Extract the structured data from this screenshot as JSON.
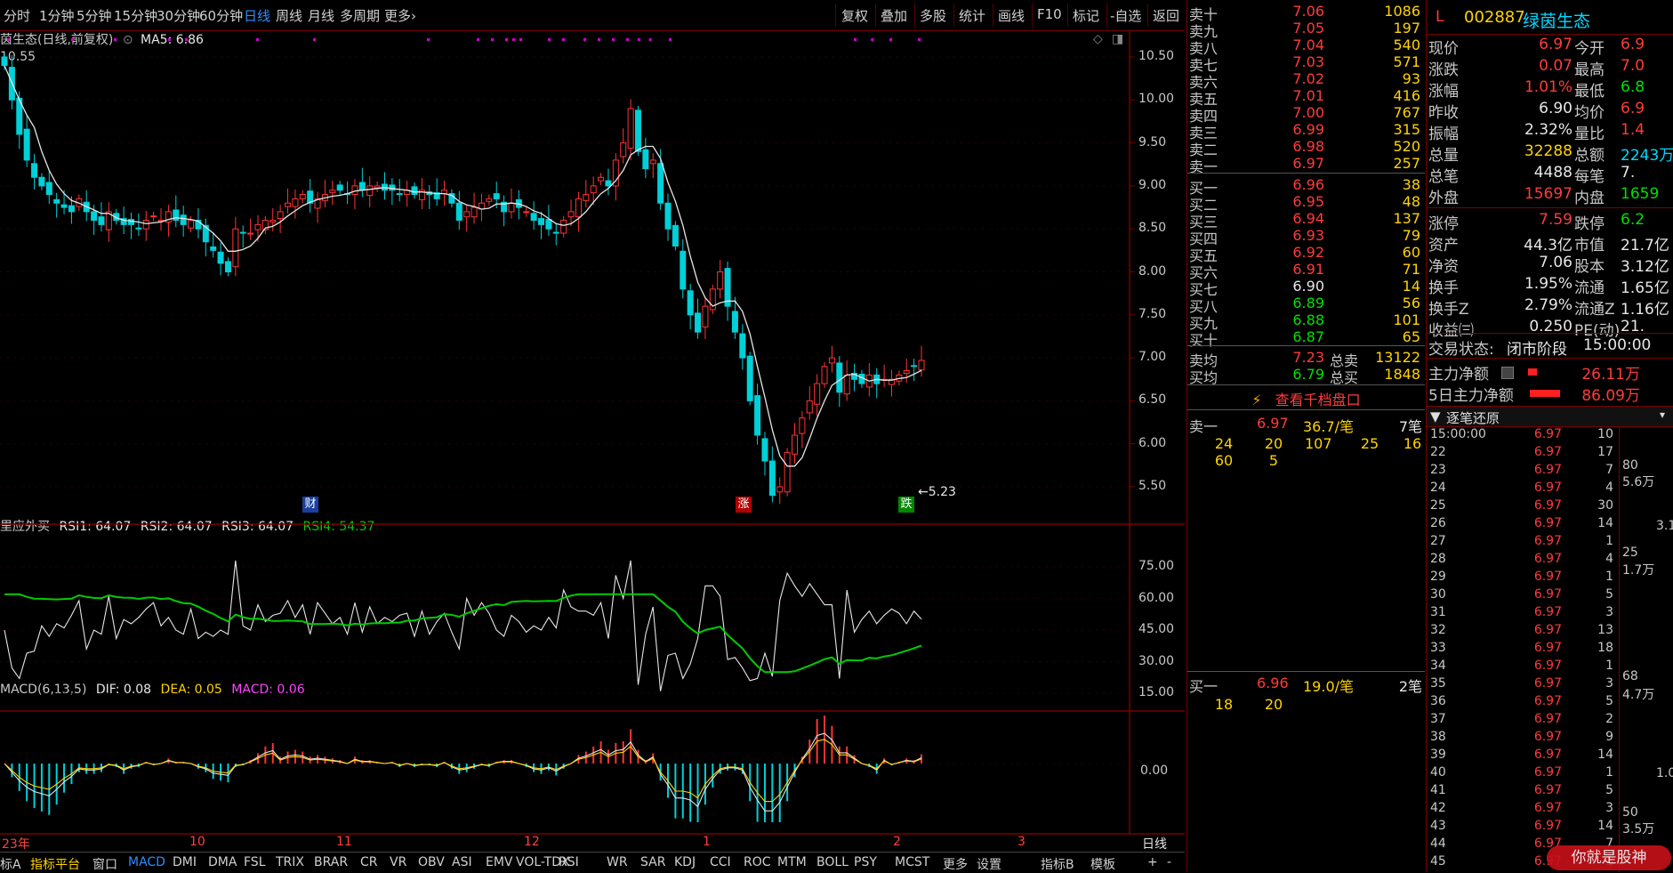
{
  "toolbar": {
    "periods": [
      "分时",
      "1分钟",
      "5分钟",
      "15分钟",
      "30分钟",
      "60分钟",
      "日线",
      "周线",
      "月线",
      "多周期",
      "更多"
    ],
    "active_period": "日线",
    "right_buttons": [
      "复权",
      "叠加",
      "多股",
      "统计",
      "画线",
      "F10",
      "标记",
      "-自选",
      "返回"
    ]
  },
  "main_chart": {
    "title": "茵生态(日线,前复权)",
    "ma_label": "MA5: 6.86",
    "top_price": "10.55",
    "y_ticks": [
      "10.50",
      "10.00",
      "9.50",
      "9.00",
      "8.50",
      "8.00",
      "7.50",
      "7.00",
      "6.50",
      "6.00",
      "5.50"
    ],
    "low_marker": "5.23",
    "event_markers": [
      "财",
      "涨",
      "跌"
    ]
  },
  "rsi_panel": {
    "title": "里应外买",
    "rsi1": "RSI1: 64.07",
    "rsi2": "RSI2: 64.07",
    "rsi3": "RSI3: 64.07",
    "rsi4": "RSI4: 54.37",
    "y_ticks": [
      "75.00",
      "60.00",
      "45.00",
      "30.00",
      "15.00"
    ]
  },
  "macd_panel": {
    "title": "MACD(6,13,5)",
    "dif": "DIF: 0.08",
    "dea": "DEA: 0.05",
    "macd": "MACD: 0.06",
    "y_ticks": [
      "0.00"
    ]
  },
  "x_axis": {
    "labels": [
      "23年",
      "10",
      "11",
      "12",
      "1",
      "2",
      "3"
    ],
    "period_label": "日线"
  },
  "bottom_tabs": [
    "标A",
    "指标平台",
    "窗口",
    "MACD",
    "DMI",
    "DMA",
    "FSL",
    "TRIX",
    "BRAR",
    "CR",
    "VR",
    "OBV",
    "ASI",
    "EMV",
    "VOL-TDX",
    "RSI",
    "WR",
    "SAR",
    "KDJ",
    "CCI",
    "ROC",
    "MTM",
    "BOLL",
    "PSY",
    "MCST",
    "更多",
    "设置",
    "指标B",
    "模板",
    "+",
    "-"
  ],
  "order_book": {
    "asks": [
      {
        "label": "卖十",
        "price": "7.06",
        "volume": "1086"
      },
      {
        "label": "卖九",
        "price": "7.05",
        "volume": "197"
      },
      {
        "label": "卖八",
        "price": "7.04",
        "volume": "540"
      },
      {
        "label": "卖七",
        "price": "7.03",
        "volume": "571"
      },
      {
        "label": "卖六",
        "price": "7.02",
        "volume": "93"
      },
      {
        "label": "卖五",
        "price": "7.01",
        "volume": "416"
      },
      {
        "label": "卖四",
        "price": "7.00",
        "volume": "767"
      },
      {
        "label": "卖三",
        "price": "6.99",
        "volume": "315"
      },
      {
        "label": "卖二",
        "price": "6.98",
        "volume": "520"
      },
      {
        "label": "卖一",
        "price": "6.97",
        "volume": "257"
      }
    ],
    "bids": [
      {
        "label": "买一",
        "price": "6.96",
        "volume": "38"
      },
      {
        "label": "买二",
        "price": "6.95",
        "volume": "48"
      },
      {
        "label": "买三",
        "price": "6.94",
        "volume": "137"
      },
      {
        "label": "买四",
        "price": "6.93",
        "volume": "79"
      },
      {
        "label": "买五",
        "price": "6.92",
        "volume": "60"
      },
      {
        "label": "买六",
        "price": "6.91",
        "volume": "71"
      },
      {
        "label": "买七",
        "price": "6.90",
        "volume": "14"
      },
      {
        "label": "买八",
        "price": "6.89",
        "volume": "56"
      },
      {
        "label": "买九",
        "price": "6.88",
        "volume": "101"
      },
      {
        "label": "买十",
        "price": "6.87",
        "volume": "65"
      }
    ],
    "avg_sell_label": "卖均",
    "avg_sell": "7.23",
    "total_sell_label": "总卖",
    "total_sell": "13122",
    "avg_buy_label": "买均",
    "avg_buy": "6.79",
    "total_buy_label": "总买",
    "total_buy": "1848",
    "depth_button": "查看千档盘口",
    "sell1": {
      "label": "卖一",
      "price": "6.97",
      "per": "36.7/笔",
      "count": "7笔",
      "queue": [
        "24",
        "20",
        "107",
        "25",
        "16",
        "60",
        "5"
      ]
    },
    "buy1": {
      "label": "买一",
      "price": "6.96",
      "per": "19.0/笔",
      "count": "2笔",
      "queue": [
        "18",
        "20"
      ]
    }
  },
  "stock_info": {
    "market_tag": "L",
    "code": "002887",
    "name": "绿茵生态",
    "rows": [
      {
        "a": "现价",
        "b": "6.97",
        "bc": "red",
        "c": "今开",
        "d": "6.9",
        "dc": "red"
      },
      {
        "a": "涨跌",
        "b": "0.07",
        "bc": "red",
        "c": "最高",
        "d": "7.0",
        "dc": "red"
      },
      {
        "a": "涨幅",
        "b": "1.01%",
        "bc": "red",
        "c": "最低",
        "d": "6.8",
        "dc": "green"
      },
      {
        "a": "昨收",
        "b": "6.90",
        "bc": "white",
        "c": "均价",
        "d": "6.9",
        "dc": "red"
      },
      {
        "a": "振幅",
        "b": "2.32%",
        "bc": "white",
        "c": "量比",
        "d": "1.4",
        "dc": "red"
      },
      {
        "a": "总量",
        "b": "32288",
        "bc": "yellow",
        "c": "总额",
        "d": "2243万",
        "dc": "cyan"
      },
      {
        "a": "总笔",
        "b": "4488",
        "bc": "white",
        "c": "每笔",
        "d": "7.",
        "dc": "white"
      },
      {
        "a": "外盘",
        "b": "15697",
        "bc": "red",
        "c": "内盘",
        "d": "1659",
        "dc": "green"
      },
      {
        "a": "涨停",
        "b": "7.59",
        "bc": "red",
        "c": "跌停",
        "d": "6.2",
        "dc": "green"
      },
      {
        "a": "资产",
        "b": "44.3亿",
        "bc": "white",
        "c": "市值",
        "d": "21.7亿",
        "dc": "white"
      },
      {
        "a": "净资",
        "b": "7.06",
        "bc": "white",
        "c": "股本",
        "d": "3.12亿",
        "dc": "white"
      },
      {
        "a": "换手",
        "b": "1.95%",
        "bc": "white",
        "c": "流通",
        "d": "1.65亿",
        "dc": "white"
      },
      {
        "a": "换手Z",
        "b": "2.79%",
        "bc": "white",
        "c": "流通Z",
        "d": "1.16亿",
        "dc": "white"
      },
      {
        "a": "收益㈢",
        "b": "0.250",
        "bc": "white",
        "c": "PE(动)",
        "d": "21.",
        "dc": "white"
      }
    ],
    "trade_status_label": "交易状态:",
    "trade_status": "闭市阶段",
    "trade_time": "15:00:00",
    "main_net_label": "主力净额",
    "main_net": "26.11万",
    "main_net_5d_label": "5日主力净额",
    "main_net_5d": "86.09万",
    "tick_title": "逐笔还原",
    "ticks": [
      {
        "t": "15:00:00",
        "p": "6.97",
        "v": "10"
      },
      {
        "t": "22",
        "p": "6.97",
        "v": "17"
      },
      {
        "t": "23",
        "p": "6.97",
        "v": "7"
      },
      {
        "t": "24",
        "p": "6.97",
        "v": "4"
      },
      {
        "t": "25",
        "p": "6.97",
        "v": "30"
      },
      {
        "t": "26",
        "p": "6.97",
        "v": "14"
      },
      {
        "t": "27",
        "p": "6.97",
        "v": "1"
      },
      {
        "t": "28",
        "p": "6.97",
        "v": "4"
      },
      {
        "t": "29",
        "p": "6.97",
        "v": "1"
      },
      {
        "t": "30",
        "p": "6.97",
        "v": "5"
      },
      {
        "t": "31",
        "p": "6.97",
        "v": "3"
      },
      {
        "t": "32",
        "p": "6.97",
        "v": "13"
      },
      {
        "t": "33",
        "p": "6.97",
        "v": "18"
      },
      {
        "t": "34",
        "p": "6.97",
        "v": "1"
      },
      {
        "t": "35",
        "p": "6.97",
        "v": "3"
      },
      {
        "t": "36",
        "p": "6.97",
        "v": "5"
      },
      {
        "t": "37",
        "p": "6.97",
        "v": "2"
      },
      {
        "t": "38",
        "p": "6.97",
        "v": "9"
      },
      {
        "t": "39",
        "p": "6.97",
        "v": "14"
      },
      {
        "t": "40",
        "p": "6.97",
        "v": "1"
      },
      {
        "t": "41",
        "p": "6.97",
        "v": "5"
      },
      {
        "t": "42",
        "p": "6.97",
        "v": "3"
      },
      {
        "t": "43",
        "p": "6.97",
        "v": "14"
      },
      {
        "t": "44",
        "p": "6.97",
        "v": "7"
      },
      {
        "t": "45",
        "p": "6.97",
        "v": "1"
      }
    ],
    "volume_side_labels": [
      "80",
      "5.6万",
      "3.17",
      "25",
      "1.7万",
      "68",
      "4.7万",
      "1.07",
      "50",
      "3.5万"
    ],
    "watermark": "你就是股神"
  }
}
